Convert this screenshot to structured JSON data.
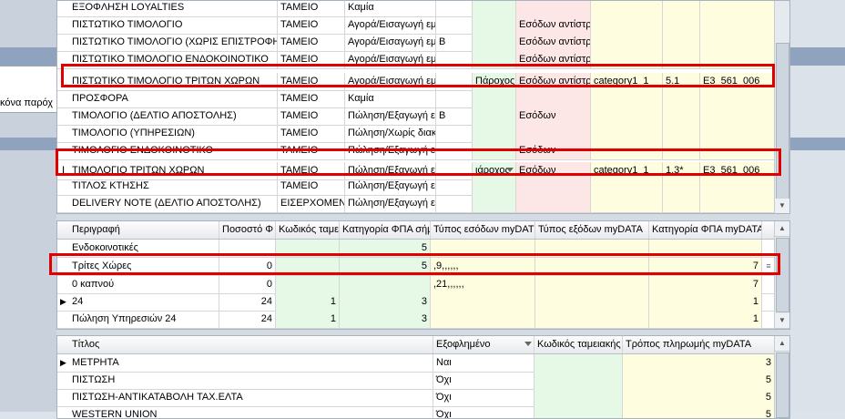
{
  "background": {
    "left_text": "κόνα παρόχ"
  },
  "grid1": {
    "rows": [
      {
        "name": "ΕΞΟΦΛΗΣΗ LOYALTIES",
        "c2": "ΤΑΜΕΙΟ",
        "c3": "Καμία",
        "c4": "",
        "c5": "",
        "c6": "",
        "c7": "",
        "c8": "",
        "c9": ""
      },
      {
        "name": "ΠΙΣΤΩΤΙΚΟ ΤΙΜΟΛΟΓΙΟ",
        "c2": "ΤΑΜΕΙΟ",
        "c3": "Αγορά/Εισαγωγή εμ",
        "c4": "",
        "c5": "",
        "c6": "Εσόδων αντίστρ",
        "c7": "",
        "c8": "",
        "c9": ""
      },
      {
        "name": "ΠΙΣΤΩΤΙΚΟ ΤΙΜΟΛΟΓΙΟ (ΧΩΡΙΣ ΕΠΙΣΤΡΟΦΗ)",
        "c2": "ΤΑΜΕΙΟ",
        "c3": "Αγορά/Εισαγωγή εμ",
        "c4": "B",
        "c5": "",
        "c6": "Εσόδων αντίστρ",
        "c7": "",
        "c8": "",
        "c9": ""
      },
      {
        "name": "ΠΙΣΤΩΤΙΚΟ ΤΙΜΟΛΟΓΙΟ ΕΝΔΟΚΟΙΝΟΤΙΚΟ",
        "c2": "ΤΑΜΕΙΟ",
        "c3": "Αγορά/Εισαγωγή εμ",
        "c4": "",
        "c5": "",
        "c6": "Εσόδων αντίστρ",
        "c7": "",
        "c8": "",
        "c9": ""
      },
      {
        "name": "ΠΙΣΤΩΤΙΚΟ ΤΙΜΟΛΟΓΙΟ ΤΡΙΤΩΝ ΧΩΡΩΝ",
        "c2": "ΤΑΜΕΙΟ",
        "c3": "Αγορά/Εισαγωγή εμ",
        "c4": "",
        "c5": "Πάροχος",
        "c6": "Εσόδων αντίστρ",
        "c7": "category1_1",
        "c8": "5.1",
        "c9": "E3_561_006"
      },
      {
        "name": "ΠΡΟΣΦΟΡΑ",
        "c2": "ΤΑΜΕΙΟ",
        "c3": "Καμία",
        "c4": "",
        "c5": "",
        "c6": "",
        "c7": "",
        "c8": "",
        "c9": ""
      },
      {
        "name": "ΤΙΜΟΛΟΓΙΟ (ΔΕΛΤΙΟ ΑΠΟΣΤΟΛΗΣ)",
        "c2": "ΤΑΜΕΙΟ",
        "c3": "Πώληση/Εξαγωγή ε",
        "c4": "B",
        "c5": "",
        "c6": "Εσόδων",
        "c7": "",
        "c8": "",
        "c9": ""
      },
      {
        "name": "ΤΙΜΟΛΟΓΙΟ (ΥΠΗΡΕΣΙΩΝ)",
        "c2": "ΤΑΜΕΙΟ",
        "c3": "Πώληση/Χωρίς διακ",
        "c4": "",
        "c5": "",
        "c6": "",
        "c7": "",
        "c8": "",
        "c9": ""
      },
      {
        "name": "ΤΙΜΟΛΟΓΙΟ ΕΝΔΟΚΟΙΝΟΤΙΚΟ",
        "c2": "ΤΑΜΕΙΟ",
        "c3": "Πώληση/Εξαγωγή ε",
        "c4": "",
        "c5": "",
        "c6": "Εσόδων",
        "c7": "",
        "c8": "",
        "c9": ""
      },
      {
        "name": "ΤΙΜΟΛΟΓΙΟ ΤΡΙΤΩΝ ΧΩΡΩΝ",
        "c2": "ΤΑΜΕΙΟ",
        "c3": "Πώληση/Εξαγωγή ε",
        "c4": "",
        "c5": "ιάροχος",
        "c6": "Εσόδων",
        "c7": "category1_1",
        "c8": "1.3*",
        "c9": "E3_561_006"
      },
      {
        "name": "ΤΙΤΛΟΣ ΚΤΗΣΗΣ",
        "c2": "ΤΑΜΕΙΟ",
        "c3": "Πώληση/Εξαγωγή ε",
        "c4": "",
        "c5": "",
        "c6": "",
        "c7": "",
        "c8": "",
        "c9": ""
      },
      {
        "name": "DELIVERY NOTE (ΔΕΛΤΙΟ ΑΠΟΣΤΟΛΗΣ)",
        "c2": "ΕΙΣΕΡΧΟΜΕΝΑ",
        "c3": "Πώληση/Εξαγωγή ε",
        "c4": "",
        "c5": "",
        "c6": "",
        "c7": "",
        "c8": "",
        "c9": ""
      }
    ]
  },
  "grid2": {
    "headers": [
      "Περιγραφή",
      "Ποσοστό Φ",
      "Κωδικός ταμει",
      "Κατηγορία ΦΠΑ σήμ",
      "Τύπος εσόδων myDAT",
      "Τύπος εξόδων myDATA",
      "Κατηγορία ΦΠΑ myDATA"
    ],
    "rows": [
      {
        "desc": "Ενδοκοινοτικές",
        "pct": "",
        "code": "",
        "cat": "5",
        "income": "",
        "expense": "",
        "vat": ""
      },
      {
        "desc": "Τρίτες Χώρες",
        "pct": "0",
        "code": "",
        "cat": "5",
        "income": ",9,,,,,,",
        "expense": "",
        "vat": "7"
      },
      {
        "desc": "0 καπνού",
        "pct": "0",
        "code": "",
        "cat": "",
        "income": ",21,,,,,,",
        "expense": "",
        "vat": "7"
      },
      {
        "desc": "24",
        "pct": "24",
        "code": "1",
        "cat": "3",
        "income": "",
        "expense": "",
        "vat": "1"
      },
      {
        "desc": "Πώληση Υπηρεσιών 24",
        "pct": "24",
        "code": "1",
        "cat": "3",
        "income": "",
        "expense": "",
        "vat": "1"
      }
    ]
  },
  "grid3": {
    "headers": [
      "Τίτλος",
      "Εξοφλημένο",
      "Κωδικός ταμειακής",
      "Τρόπος πληρωμής myDATA"
    ],
    "rows": [
      {
        "title": "ΜΕΤΡΗΤΑ",
        "paid": "Ναι",
        "code": "",
        "method": "3"
      },
      {
        "title": "ΠΙΣΤΩΣΗ",
        "paid": "Όχι",
        "code": "",
        "method": "5"
      },
      {
        "title": "ΠΙΣΤΩΣΗ-ΑΝΤΙΚΑΤΑΒΟΛΗ ΤΑΧ.ΕΛΤΑ",
        "paid": "Όχι",
        "code": "",
        "method": "5"
      },
      {
        "title": "WESTERN UNION",
        "paid": "Όχι",
        "code": "",
        "method": "5"
      }
    ]
  },
  "colors": {
    "highlight": "#e00000",
    "green": "#e6f8e6",
    "pink": "#fde6e6",
    "yellow": "#fffde0"
  }
}
